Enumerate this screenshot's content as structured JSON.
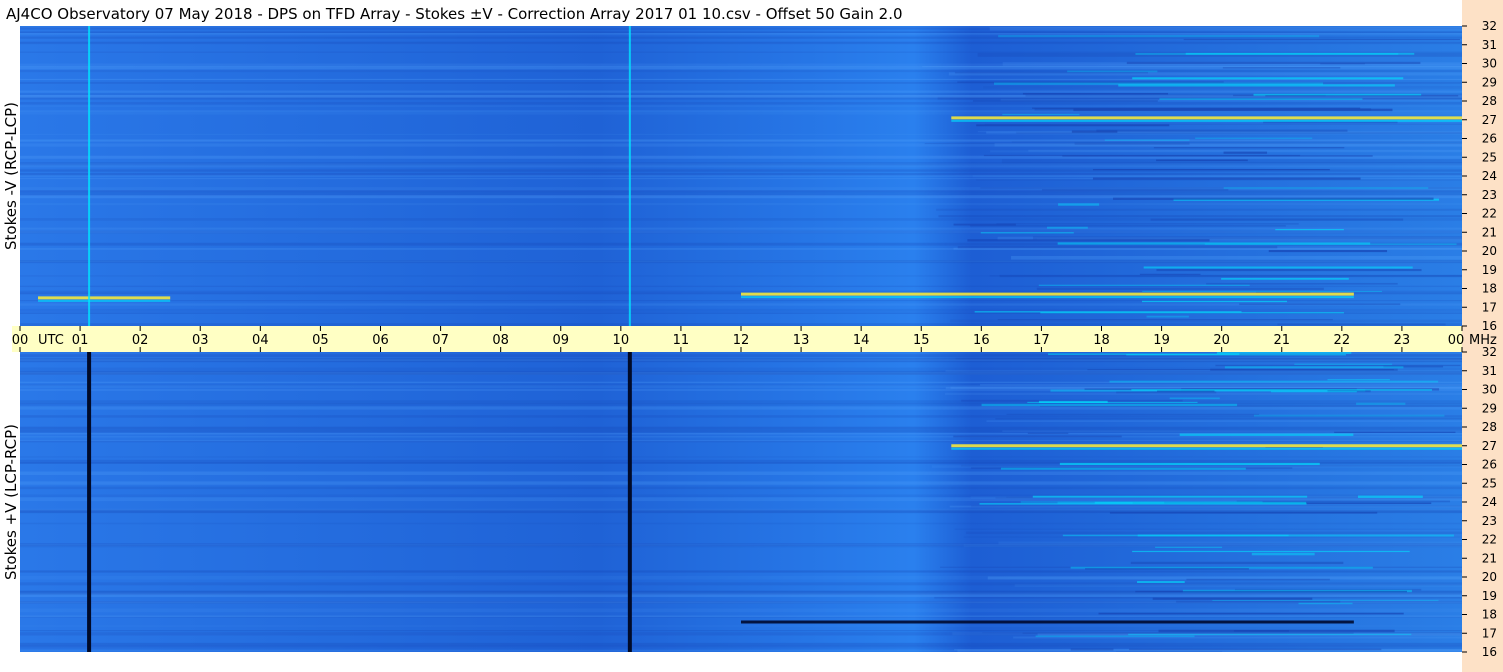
{
  "title": "AJ4CO Observatory  07 May 2018  -  DPS on TFD Array  -  Stokes ±V  -  Correction Array 2017 01 10.csv  -  Offset 50  Gain 2.0",
  "colors": {
    "background": "#1e5fd8",
    "background_dark": "#1540b0",
    "strip": "#fde1c6",
    "utc_bar": "#ffffc4",
    "highlight": "#00e6ff",
    "hot": "#ffee33"
  },
  "chart_data": [
    {
      "type": "heatmap",
      "panel": "top",
      "ylabel": "Stokes -V  (RCP-LCP)",
      "x_range_utc": [
        0,
        24
      ],
      "y_range_mhz": [
        16,
        32
      ],
      "y_ticks": [
        "32",
        "31",
        "30",
        "29",
        "28",
        "27",
        "26",
        "25",
        "24",
        "23",
        "22",
        "21",
        "20",
        "19",
        "18",
        "17",
        "16"
      ],
      "vertical_lines_utc": [
        {
          "t": 1.15,
          "style": "bright"
        },
        {
          "t": 10.15,
          "style": "bright"
        }
      ],
      "strong_bursts": [
        {
          "t0": 12.0,
          "t1": 22.2,
          "f": 17.7,
          "style": "hot"
        },
        {
          "t0": 15.5,
          "t1": 24.0,
          "f": 27.1,
          "style": "hot"
        },
        {
          "t0": 0.3,
          "t1": 2.5,
          "f": 17.5,
          "style": "hot"
        }
      ]
    },
    {
      "type": "heatmap",
      "panel": "bottom",
      "ylabel": "Stokes +V  (LCP-RCP)",
      "x_range_utc": [
        0,
        24
      ],
      "y_range_mhz": [
        16,
        32
      ],
      "y_ticks": [
        "32",
        "31",
        "30",
        "29",
        "28",
        "27",
        "26",
        "25",
        "24",
        "23",
        "22",
        "21",
        "20",
        "19",
        "18",
        "17",
        "16"
      ],
      "vertical_lines_utc": [
        {
          "t": 1.15,
          "style": "dark"
        },
        {
          "t": 10.15,
          "style": "dark"
        }
      ],
      "strong_bursts": [
        {
          "t0": 12.0,
          "t1": 22.2,
          "f": 17.6,
          "style": "dark"
        },
        {
          "t0": 15.5,
          "t1": 24.0,
          "f": 27.0,
          "style": "hot"
        }
      ]
    }
  ],
  "x_axis": {
    "tick_labels": [
      "00",
      "01",
      "02",
      "03",
      "04",
      "05",
      "06",
      "07",
      "08",
      "09",
      "10",
      "11",
      "12",
      "13",
      "14",
      "15",
      "16",
      "17",
      "18",
      "19",
      "20",
      "21",
      "22",
      "23",
      "00"
    ],
    "utc_label": "UTC",
    "mhz_label": "MHz"
  }
}
